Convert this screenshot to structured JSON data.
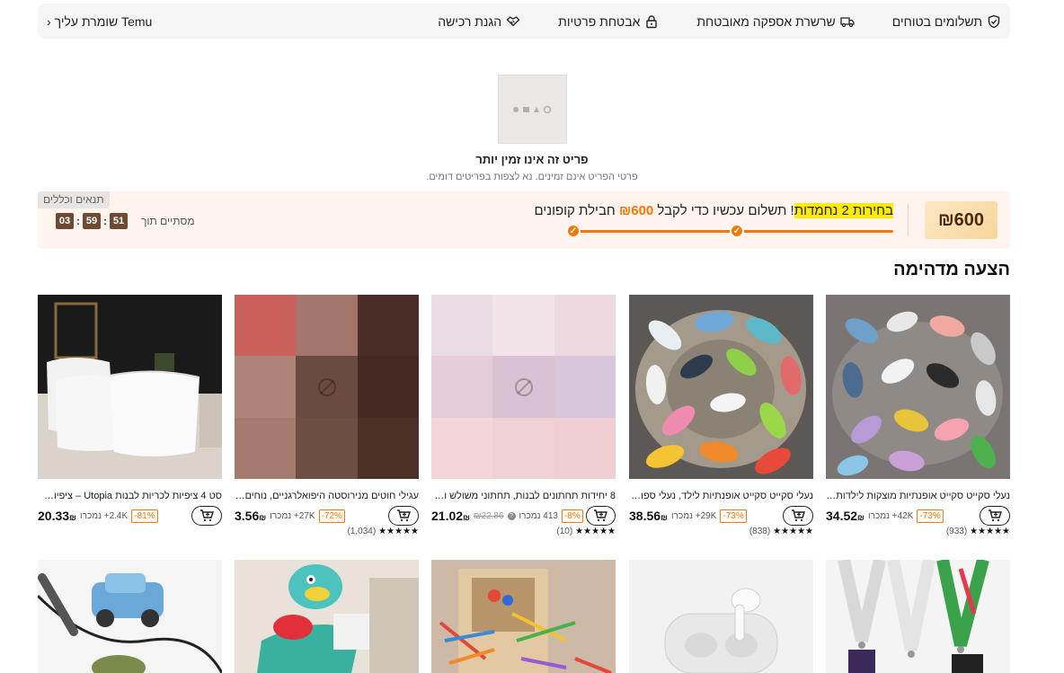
{
  "topbar": {
    "items": [
      {
        "label": "תשלומים בטוחים",
        "icon": "shield-check-icon"
      },
      {
        "label": "שרשרת אספקה מאובטחת",
        "icon": "truck-icon"
      },
      {
        "label": "אבטחת פרטיות",
        "icon": "lock-icon"
      },
      {
        "label": "הגנת רכישה",
        "icon": "handshake-icon"
      }
    ],
    "guard_label": "Temu שומרת עליך"
  },
  "unavailable": {
    "title": "פריט זה אינו זמין יותר",
    "subtitle": "פרטי הפריט אינם זמינים. נא לצפות בפריטים דומים."
  },
  "coupon": {
    "amount": "₪600",
    "message_highlight": "בחירות 2 נחמדות",
    "message_mid": "! תשלום עכשיו כדי לקבל ",
    "message_amount": "₪600",
    "message_end": " חבילת קופונים",
    "terms_label": "תנאים וכללים",
    "ends_label": "מסתיים תוך",
    "timer": {
      "h": "03",
      "m": "59",
      "s": "51"
    },
    "progress_steps_done": 2,
    "accent": "#fb7701"
  },
  "section_title": "הצעה מדהימה",
  "products": [
    {
      "title": "נעלי סקייט סקייט אופנתיות מוצקות לילדות, נעלי קנבס...",
      "price": "34.52",
      "currency": "₪",
      "sold": "42K+ נמכרו",
      "discount": "-73%",
      "rating_count": "(933)",
      "old_price": ""
    },
    {
      "title": "נעלי סקייט סקייט אופנתיות לילד, נעלי ספורט קנבס...",
      "price": "38.56",
      "currency": "₪",
      "sold": "29K+ נמכרו",
      "discount": "-73%",
      "rating_count": "(838)",
      "old_price": ""
    },
    {
      "title": "8 יחידות תחתונים לבנות, תחתוני משולש ורוד...",
      "price": "21.02",
      "currency": "₪",
      "sold": "413 נמכרו",
      "discount": "-8%",
      "rating_count": "(10)",
      "old_price": "₪22.86"
    },
    {
      "title": "עגילי חוטים מנירוסטה היפואלרגניים, נוחים ועמידים...",
      "price": "3.56",
      "currency": "₪",
      "sold": "27K+ נמכרו",
      "discount": "-72%",
      "rating_count": "(1,034)",
      "old_price": ""
    },
    {
      "title": "סט 4 ציפיות לכריות לבנות Utopia – ציפיות דקורטיביות...",
      "price": "20.33",
      "currency": "₪",
      "sold": "2.4K+ נמכרו",
      "discount": "-81%",
      "rating_count": "",
      "old_price": ""
    }
  ],
  "stars": "★★★★★"
}
